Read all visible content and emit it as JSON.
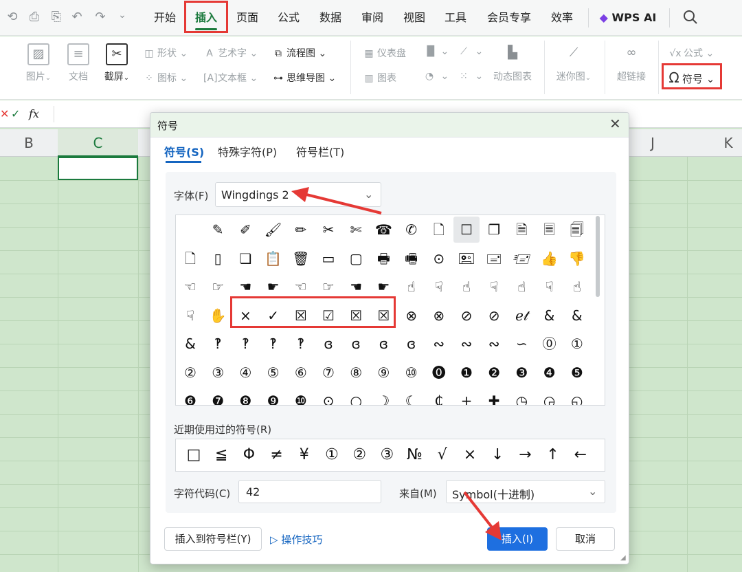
{
  "menubar": {
    "tabs": [
      "开始",
      "插入",
      "页面",
      "公式",
      "数据",
      "审阅",
      "视图",
      "工具",
      "会员专享",
      "效率"
    ],
    "wps_ai": "WPS AI"
  },
  "ribbon": {
    "picture": "图片",
    "doc": "文档",
    "screenshot": "截屏",
    "shape": "形状",
    "icon": "图标",
    "art_text": "艺术字",
    "text_box": "文本框",
    "flowchart": "流程图",
    "mindmap": "思维导图",
    "dashboard": "仪表盘",
    "chart": "图表",
    "dynamic_chart": "动态图表",
    "sparkline": "迷你图",
    "hyperlink": "超链接",
    "formula": "公式",
    "symbol": "符号"
  },
  "formula_bar": {
    "fx": "fx"
  },
  "columns": [
    "B",
    "C",
    "J",
    "K"
  ],
  "dialog": {
    "title": "符号",
    "tabs": [
      "符号(S)",
      "特殊字符(P)",
      "符号栏(T)"
    ],
    "font_label": "字体(F)",
    "font_value": "Wingdings 2",
    "symbols": [
      [
        "",
        "✎",
        "✐",
        "🖌",
        "✏",
        "✂",
        "✄",
        "☎",
        "✆",
        "🗋",
        "☐",
        "❐",
        "🗎",
        "🗏",
        "🗐"
      ],
      [
        "🗋",
        "▯",
        "❏",
        "📋",
        "🗑",
        "▭",
        "▢",
        "🖶",
        "🖷",
        "⊙",
        "🖭",
        "🖃",
        "🖅",
        "👍",
        "👎"
      ],
      [
        "☜",
        "☞",
        "☚",
        "☛",
        "☜",
        "☞",
        "☚",
        "☛",
        "☝",
        "☟",
        "☝",
        "☟",
        "☝",
        "☟",
        "☝"
      ],
      [
        "☟",
        "✋",
        "×",
        "✓",
        "☒",
        "☑",
        "☒",
        "☒",
        "⊗",
        "⊗",
        "⊘",
        "⊘",
        "ℯ𝓉",
        "&",
        "&"
      ],
      [
        "&",
        "‽",
        "‽",
        "‽",
        "‽",
        "ɞ",
        "ɞ",
        "ɞ",
        "ɞ",
        "∾",
        "∾",
        "∾",
        "∽",
        "⓪",
        "①"
      ],
      [
        "②",
        "③",
        "④",
        "⑤",
        "⑥",
        "⑦",
        "⑧",
        "⑨",
        "⑩",
        "⓿",
        "❶",
        "❷",
        "❸",
        "❹",
        "❺"
      ],
      [
        "❻",
        "❼",
        "❽",
        "❾",
        "❿",
        "⊙",
        "○",
        "☽",
        "☾",
        "₵",
        "+",
        "✚",
        "◷",
        "◶",
        "◵"
      ]
    ],
    "recent_label": "近期使用过的符号(R)",
    "recent": [
      "□",
      "≦",
      "Φ",
      "≠",
      "¥",
      "①",
      "②",
      "③",
      "№",
      "√",
      "×",
      "↓",
      "→",
      "↑",
      "←"
    ],
    "code_label": "字符代码(C)",
    "code_value": "42",
    "from_label": "来自(M)",
    "from_value": "Symbol(十进制)",
    "insert_to_bar": "插入到符号栏(Y)",
    "tips": "操作技巧",
    "insert": "插入(I)",
    "cancel": "取消"
  },
  "colors": {
    "accent": "#1b7a3d",
    "highlight": "#e53935",
    "primary": "#1e6fe0"
  }
}
